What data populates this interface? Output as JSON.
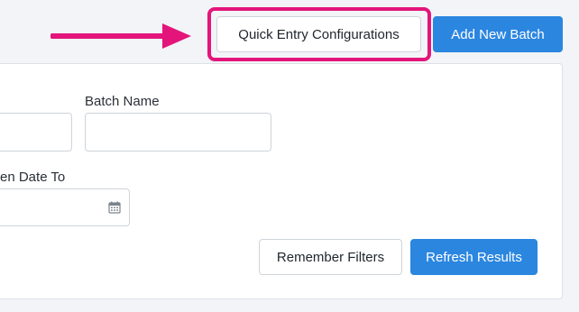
{
  "header": {
    "quick_entry_label": "Quick Entry Configurations",
    "add_batch_label": "Add New Batch"
  },
  "filters": {
    "batch_name_label": "Batch Name",
    "batch_name_value": "",
    "partial_field_value": "",
    "open_date_to_label": "en Date To",
    "open_date_to_value": ""
  },
  "actions": {
    "remember_filters_label": "Remember Filters",
    "refresh_results_label": "Refresh Results"
  },
  "annotations": {
    "highlight_color": "#e3157b"
  },
  "colors": {
    "primary": "#2b86e0"
  },
  "icons": {
    "date_picker": "calendar-icon",
    "annotation_pointer": "arrow-right-icon"
  }
}
